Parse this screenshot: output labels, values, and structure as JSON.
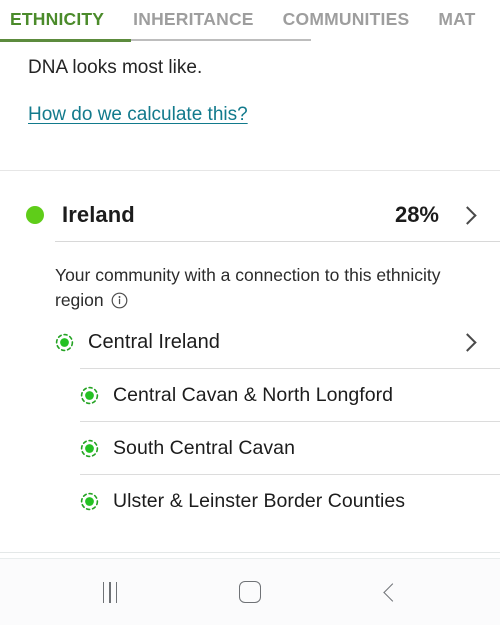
{
  "tabs": [
    {
      "label": "ETHNICITY",
      "active": true
    },
    {
      "label": "INHERITANCE",
      "active": false
    },
    {
      "label": "COMMUNITIES",
      "active": false
    },
    {
      "label": "MAT",
      "active": false
    }
  ],
  "intro": {
    "text": "DNA looks most like.",
    "link_label": "How do we calculate this?"
  },
  "region": {
    "name": "Ireland",
    "percent": "28%",
    "dot_color": "#5fcd19",
    "chevron_icon": "chevron-right-icon"
  },
  "community_section": {
    "caption": "Your community with a connection to this ethnicity region",
    "info_icon": "info-circle-icon",
    "parent": {
      "label": "Central Ireland",
      "icon": "community-dotted-circle-icon",
      "chevron_icon": "chevron-right-icon"
    },
    "children": [
      {
        "label": "Central Cavan & North Longford",
        "icon": "community-dotted-circle-icon"
      },
      {
        "label": "South Central Cavan",
        "icon": "community-dotted-circle-icon"
      },
      {
        "label": "Ulster & Leinster Border Counties",
        "icon": "community-dotted-circle-icon"
      }
    ]
  },
  "navbar": {
    "recents_label": "recents-icon",
    "home_label": "home-icon",
    "back_label": "back-icon"
  },
  "colors": {
    "active_tab": "#4b8b2b",
    "inactive_tab": "#9e9e9e",
    "link": "#127a8c",
    "community_green": "#24a323"
  }
}
